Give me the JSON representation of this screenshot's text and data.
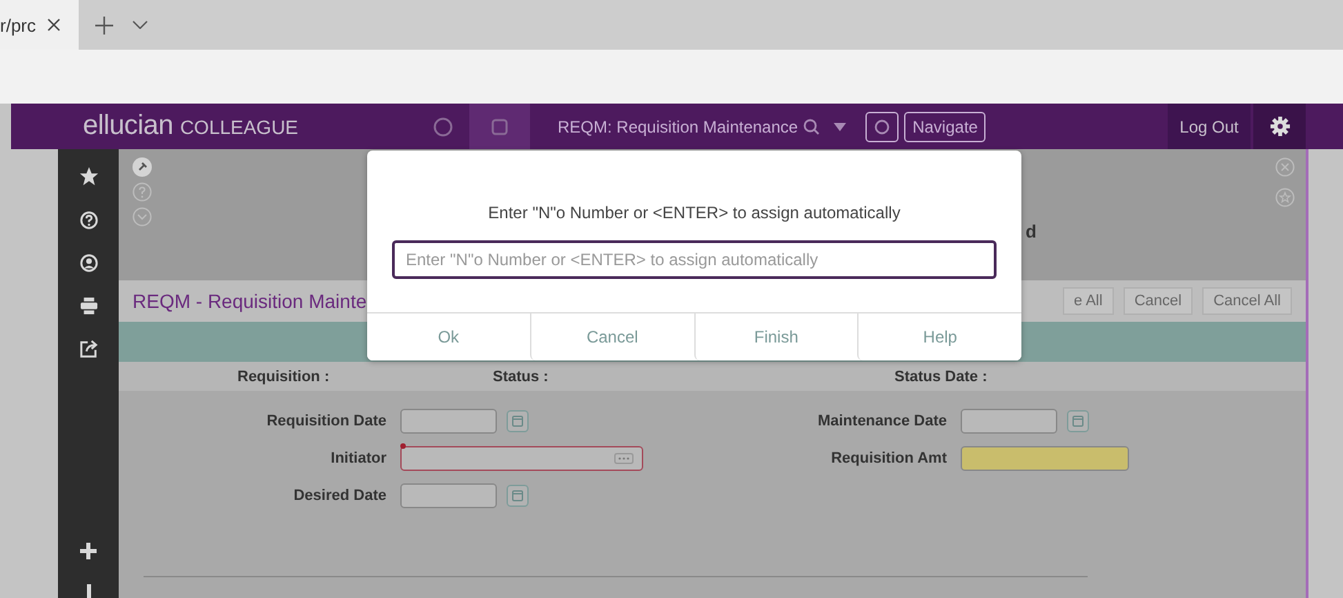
{
  "browser": {
    "tab": {
      "title": "r/prc"
    }
  },
  "header": {
    "logo_brand": "ellucian",
    "logo_product": "COLLEAGUE",
    "form_title": "REQM: Requisition Maintenance",
    "navigate": "Navigate",
    "logout": "Log Out"
  },
  "form_title_fragment": "d",
  "breadcrumb": "REQM - Requisition Mainte",
  "toolbar_buttons": [
    "e All",
    "Cancel",
    "Cancel All"
  ],
  "summary": [
    "Requisition :",
    "Status :",
    "Status Date :"
  ],
  "fields_left": [
    {
      "label": "Requisition Date",
      "kind": "date",
      "required": false
    },
    {
      "label": "Initiator",
      "kind": "lookup",
      "required": true
    },
    {
      "label": "Desired Date",
      "kind": "date",
      "required": false
    }
  ],
  "fields_right": [
    {
      "label": "Maintenance Date",
      "kind": "date",
      "required": false
    },
    {
      "label": "Requisition Amt",
      "kind": "amount",
      "required": false
    }
  ],
  "dialog": {
    "message": "Enter \"N\"o Number or <ENTER> to assign automatically",
    "placeholder": "Enter \"N\"o Number or <ENTER> to assign automatically",
    "buttons": [
      "Ok",
      "Cancel",
      "Finish",
      "Help"
    ]
  }
}
